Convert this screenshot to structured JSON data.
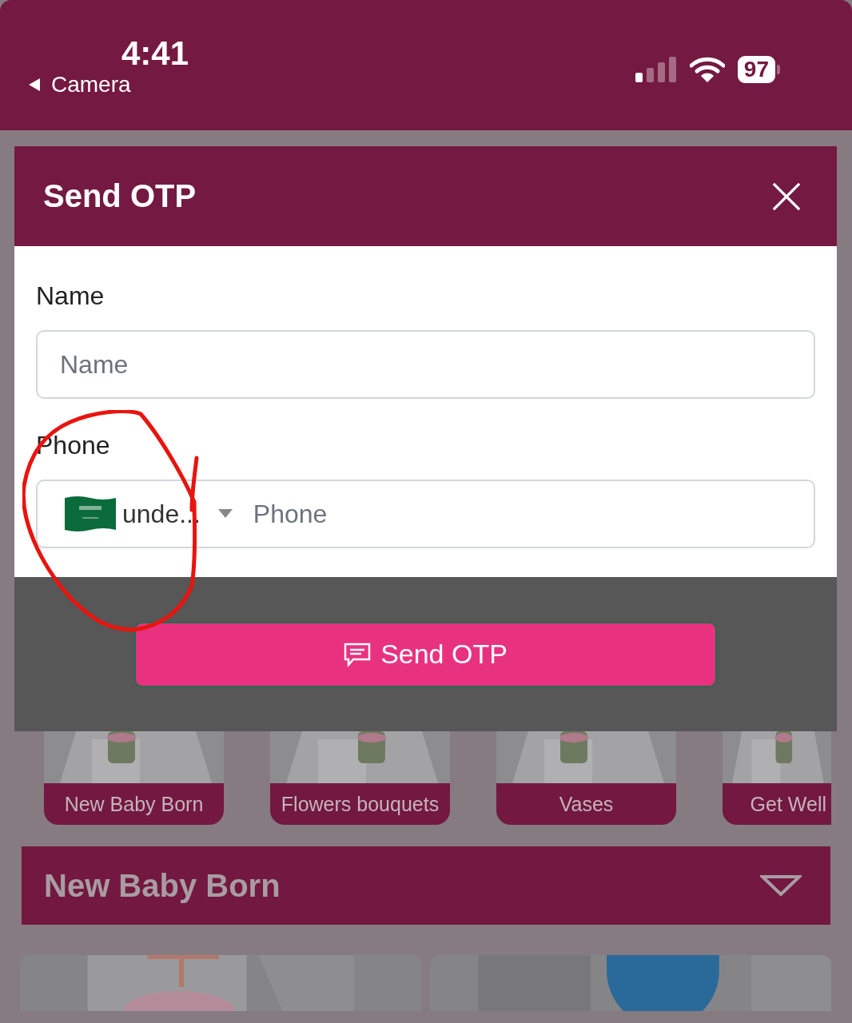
{
  "status_bar": {
    "time": "4:41",
    "back_label": "Camera",
    "battery": "97"
  },
  "modal": {
    "title": "Send OTP",
    "fields": [
      {
        "kind": "text",
        "label": "Name",
        "placeholder": "Name"
      },
      {
        "kind": "phone",
        "label": "Phone",
        "country": "unde...",
        "placeholder": "Phone"
      }
    ],
    "button": "Send OTP"
  },
  "categories": [
    {
      "label": "New Baby Born"
    },
    {
      "label": "Flowers bouquets"
    },
    {
      "label": "Vases"
    },
    {
      "label": "Get Well"
    }
  ],
  "section": {
    "title": "New Baby Born"
  }
}
